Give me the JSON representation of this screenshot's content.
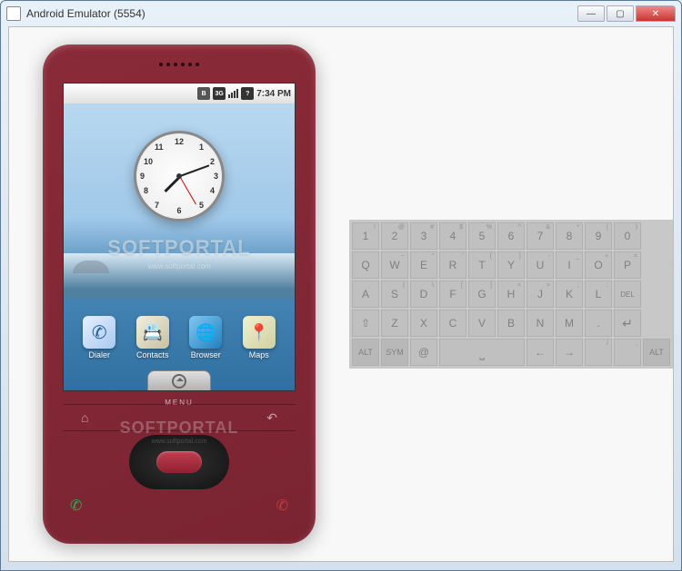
{
  "window": {
    "title": "Android Emulator (5554)"
  },
  "statusbar": {
    "bluetooth": "B",
    "threeg": "3G",
    "signal": true,
    "unknown": "?",
    "time": "7:34 PM"
  },
  "clock": {
    "numbers": [
      "12",
      "1",
      "2",
      "3",
      "4",
      "5",
      "6",
      "7",
      "8",
      "9",
      "10",
      "11"
    ]
  },
  "apps": [
    {
      "label": "Dialer",
      "icon": "dialer"
    },
    {
      "label": "Contacts",
      "icon": "contacts"
    },
    {
      "label": "Browser",
      "icon": "browser"
    },
    {
      "label": "Maps",
      "icon": "maps"
    }
  ],
  "phone": {
    "menu": "MENU"
  },
  "watermark": {
    "main": "SOFTPORTAL",
    "sub": "www.softportal.com"
  },
  "keyboard": {
    "rows": [
      [
        {
          "k": "1",
          "s": "!"
        },
        {
          "k": "2",
          "s": "@"
        },
        {
          "k": "3",
          "s": "#"
        },
        {
          "k": "4",
          "s": "$"
        },
        {
          "k": "5",
          "s": "%"
        },
        {
          "k": "6",
          "s": "^"
        },
        {
          "k": "7",
          "s": "&"
        },
        {
          "k": "8",
          "s": "*"
        },
        {
          "k": "9",
          "s": "("
        },
        {
          "k": "0",
          "s": ")"
        }
      ],
      [
        {
          "k": "Q"
        },
        {
          "k": "W",
          "s": "~"
        },
        {
          "k": "E",
          "s": "\""
        },
        {
          "k": "R",
          "s": "'"
        },
        {
          "k": "T",
          "s": "{"
        },
        {
          "k": "Y",
          "s": "}"
        },
        {
          "k": "U",
          "s": "-"
        },
        {
          "k": "I",
          "s": "_"
        },
        {
          "k": "O",
          "s": "+"
        },
        {
          "k": "P",
          "s": "="
        }
      ],
      [
        {
          "k": "A"
        },
        {
          "k": "S",
          "s": "|"
        },
        {
          "k": "D",
          "s": "\\"
        },
        {
          "k": "F",
          "s": "["
        },
        {
          "k": "G",
          "s": "]"
        },
        {
          "k": "H",
          "s": "<"
        },
        {
          "k": "J",
          "s": ">"
        },
        {
          "k": "K",
          "s": ";"
        },
        {
          "k": "L",
          "s": ":"
        },
        {
          "k": "DEL",
          "cls": "del"
        }
      ],
      [
        {
          "k": "",
          "cls": "shift"
        },
        {
          "k": "Z"
        },
        {
          "k": "X"
        },
        {
          "k": "C"
        },
        {
          "k": "V"
        },
        {
          "k": "B"
        },
        {
          "k": "N"
        },
        {
          "k": "M"
        },
        {
          "k": "."
        },
        {
          "k": "",
          "cls": "enter"
        }
      ],
      [
        {
          "k": "ALT",
          "cls": "alt"
        },
        {
          "k": "SYM",
          "cls": "alt"
        },
        {
          "k": "@"
        },
        {
          "k": "",
          "cls": "space wide"
        },
        {
          "k": "←",
          "cls": "arrow"
        },
        {
          "k": "→",
          "cls": "arrow"
        },
        {
          "k": "",
          "s": "/",
          "cls": ""
        },
        {
          "k": "",
          "s": ",",
          "cls": ""
        },
        {
          "k": "ALT",
          "cls": "alt"
        }
      ]
    ]
  }
}
